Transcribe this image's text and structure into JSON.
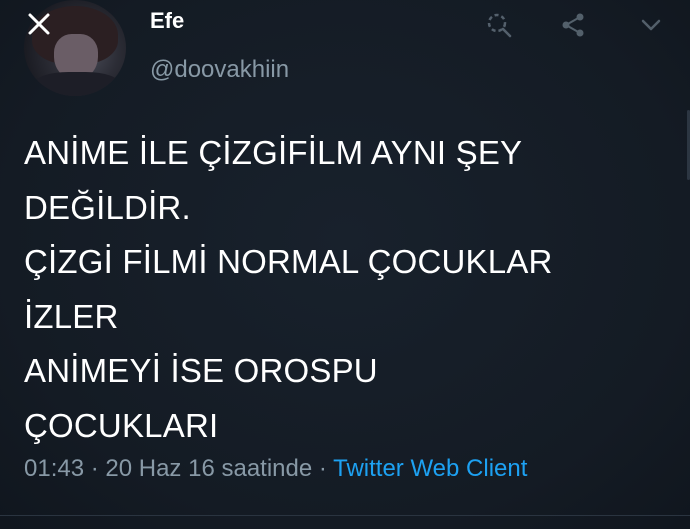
{
  "profile": {
    "display_name": "Efe",
    "handle": "@doovakhiin"
  },
  "toolbar": {
    "close_icon": "close-icon",
    "zoom_icon": "zoom-icon",
    "share_icon": "share-icon",
    "menu_icon": "chevron-down-icon"
  },
  "tweet": {
    "lines": [
      "ANİME İLE ÇİZGİFİLM AYNI ŞEY",
      "DEĞİLDİR.",
      "ÇİZGİ FİLMİ NORMAL ÇOCUKLAR",
      "İZLER",
      "ANİMEYİ İSE OROSPU",
      "ÇOCUKLARI"
    ]
  },
  "meta": {
    "time": "01:43",
    "separator": " · ",
    "date": "20 Haz 16 saatinde",
    "separator2": " · ",
    "client": "Twitter Web Client"
  },
  "colors": {
    "background": "#151d27",
    "text": "#ffffff",
    "secondary": "#8899a6",
    "link": "#1da1f2"
  }
}
